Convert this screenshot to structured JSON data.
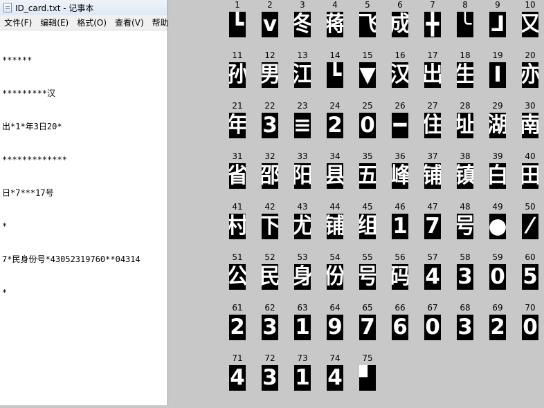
{
  "notepad": {
    "title": "ID_card.txt - 记事本",
    "menu": [
      "文件(F)",
      "编辑(E)",
      "格式(O)",
      "查看(V)",
      "帮助"
    ],
    "lines": [
      "******",
      "*********汉",
      "出*1*年3日20*",
      "*************",
      "日*7***17号",
      "*",
      "7*民身份号*43052319760**04314",
      "*"
    ]
  },
  "segments": [
    {
      "label": "1",
      "glyph": "┗"
    },
    {
      "label": "2",
      "glyph": "ⅴ"
    },
    {
      "label": "3",
      "glyph": "冬"
    },
    {
      "label": "4",
      "glyph": "蒋"
    },
    {
      "label": "5",
      "glyph": "飞"
    },
    {
      "label": "6",
      "glyph": "成"
    },
    {
      "label": "7",
      "glyph": "╋"
    },
    {
      "label": "8",
      "glyph": "╰"
    },
    {
      "label": "9",
      "glyph": "⅃"
    },
    {
      "label": "10",
      "glyph": "又"
    },
    {
      "label": "11",
      "glyph": "孙"
    },
    {
      "label": "12",
      "glyph": "男"
    },
    {
      "label": "13",
      "glyph": "江"
    },
    {
      "label": "14",
      "glyph": "┗"
    },
    {
      "label": "15",
      "glyph": "▼"
    },
    {
      "label": "16",
      "glyph": "汉"
    },
    {
      "label": "17",
      "glyph": "出"
    },
    {
      "label": "18",
      "glyph": "生"
    },
    {
      "label": "19",
      "glyph": "Ⅰ"
    },
    {
      "label": "20",
      "glyph": "亦"
    },
    {
      "label": "21",
      "glyph": "年"
    },
    {
      "label": "22",
      "glyph": "3"
    },
    {
      "label": "23",
      "glyph": "≡"
    },
    {
      "label": "24",
      "glyph": "2"
    },
    {
      "label": "25",
      "glyph": "0"
    },
    {
      "label": "26",
      "glyph": "━"
    },
    {
      "label": "27",
      "glyph": "住"
    },
    {
      "label": "28",
      "glyph": "址"
    },
    {
      "label": "29",
      "glyph": "湖"
    },
    {
      "label": "30",
      "glyph": "南"
    },
    {
      "label": "31",
      "glyph": "省"
    },
    {
      "label": "32",
      "glyph": "邵"
    },
    {
      "label": "33",
      "glyph": "阳"
    },
    {
      "label": "34",
      "glyph": "县"
    },
    {
      "label": "35",
      "glyph": "五"
    },
    {
      "label": "36",
      "glyph": "峰"
    },
    {
      "label": "37",
      "glyph": "铺"
    },
    {
      "label": "38",
      "glyph": "镇"
    },
    {
      "label": "39",
      "glyph": "白"
    },
    {
      "label": "40",
      "glyph": "田"
    },
    {
      "label": "41",
      "glyph": "村"
    },
    {
      "label": "42",
      "glyph": "下"
    },
    {
      "label": "43",
      "glyph": "尤"
    },
    {
      "label": "44",
      "glyph": "铺"
    },
    {
      "label": "45",
      "glyph": "组"
    },
    {
      "label": "46",
      "glyph": "1"
    },
    {
      "label": "47",
      "glyph": "7"
    },
    {
      "label": "48",
      "glyph": "号"
    },
    {
      "label": "49",
      "glyph": "●"
    },
    {
      "label": "50",
      "glyph": "⁄"
    },
    {
      "label": "51",
      "glyph": "公"
    },
    {
      "label": "52",
      "glyph": "民"
    },
    {
      "label": "53",
      "glyph": "身"
    },
    {
      "label": "54",
      "glyph": "份"
    },
    {
      "label": "55",
      "glyph": "号"
    },
    {
      "label": "56",
      "glyph": "码"
    },
    {
      "label": "57",
      "glyph": "4"
    },
    {
      "label": "58",
      "glyph": "3"
    },
    {
      "label": "59",
      "glyph": "0"
    },
    {
      "label": "60",
      "glyph": "5"
    },
    {
      "label": "61",
      "glyph": "2"
    },
    {
      "label": "62",
      "glyph": "3"
    },
    {
      "label": "63",
      "glyph": "1"
    },
    {
      "label": "64",
      "glyph": "9"
    },
    {
      "label": "65",
      "glyph": "7"
    },
    {
      "label": "66",
      "glyph": "6"
    },
    {
      "label": "67",
      "glyph": "0"
    },
    {
      "label": "68",
      "glyph": "3"
    },
    {
      "label": "69",
      "glyph": "2"
    },
    {
      "label": "70",
      "glyph": "0"
    },
    {
      "label": "71",
      "glyph": "4"
    },
    {
      "label": "72",
      "glyph": "3"
    },
    {
      "label": "73",
      "glyph": "1"
    },
    {
      "label": "74",
      "glyph": "4"
    },
    {
      "label": "75",
      "glyph": "▘"
    }
  ]
}
